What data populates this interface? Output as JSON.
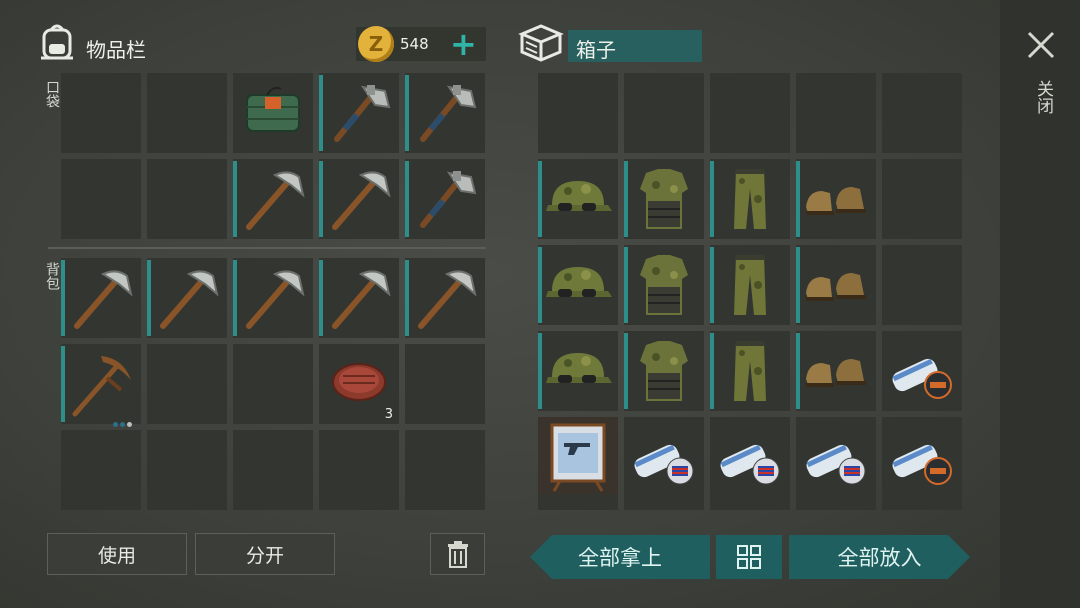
{
  "inventory": {
    "title": "物品栏",
    "pocket_label": "口袋",
    "backpack_label": "背包",
    "coins": "548",
    "coin_symbol": "Z",
    "plus": "+",
    "pocket_slots": [
      {
        "item": "empty"
      },
      {
        "item": "empty"
      },
      {
        "item": "tnt-bundle-icon"
      },
      {
        "item": "hatchet-icon"
      },
      {
        "item": "hatchet-icon"
      },
      {
        "item": "empty"
      },
      {
        "item": "empty"
      },
      {
        "item": "pickaxe-icon"
      },
      {
        "item": "pickaxe-icon"
      },
      {
        "item": "hatchet-icon"
      }
    ],
    "backpack_slots": [
      {
        "item": "pickaxe-icon"
      },
      {
        "item": "pickaxe-icon"
      },
      {
        "item": "pickaxe-icon"
      },
      {
        "item": "pickaxe-icon"
      },
      {
        "item": "pickaxe-icon"
      },
      {
        "item": "double-pickaxe-icon"
      },
      {
        "item": "empty"
      },
      {
        "item": "empty"
      },
      {
        "item": "steak-icon",
        "count": "3"
      },
      {
        "item": "empty"
      },
      {
        "item": "empty"
      },
      {
        "item": "empty"
      },
      {
        "item": "empty"
      },
      {
        "item": "empty"
      },
      {
        "item": "empty"
      }
    ],
    "buttons": {
      "use": "使用",
      "split": "分开"
    }
  },
  "box": {
    "title": "箱子",
    "slots": [
      {
        "item": "empty"
      },
      {
        "item": "empty"
      },
      {
        "item": "empty"
      },
      {
        "item": "empty"
      },
      {
        "item": "empty"
      },
      {
        "item": "camo-cap-icon"
      },
      {
        "item": "armored-vest-icon"
      },
      {
        "item": "camo-pants-icon"
      },
      {
        "item": "boots-icon"
      },
      {
        "item": "empty"
      },
      {
        "item": "camo-cap-icon"
      },
      {
        "item": "armored-vest-icon"
      },
      {
        "item": "camo-pants-icon"
      },
      {
        "item": "boots-icon"
      },
      {
        "item": "empty"
      },
      {
        "item": "camo-cap-icon"
      },
      {
        "item": "armored-vest-icon"
      },
      {
        "item": "camo-pants-icon"
      },
      {
        "item": "boots-icon"
      },
      {
        "item": "blueprint-lastday-icon"
      },
      {
        "item": "weapon-rack-blueprint-icon"
      },
      {
        "item": "blueprint-flag-icon"
      },
      {
        "item": "blueprint-flag-icon"
      },
      {
        "item": "blueprint-flag-icon"
      },
      {
        "item": "blueprint-lastday-icon"
      }
    ],
    "buttons": {
      "take_all": "全部拿上",
      "put_all": "全部放入"
    }
  },
  "close_label": "关闭",
  "colors": {
    "accent": "#2e8f8a",
    "coin": "#e2b23a",
    "slot": "#323530"
  }
}
